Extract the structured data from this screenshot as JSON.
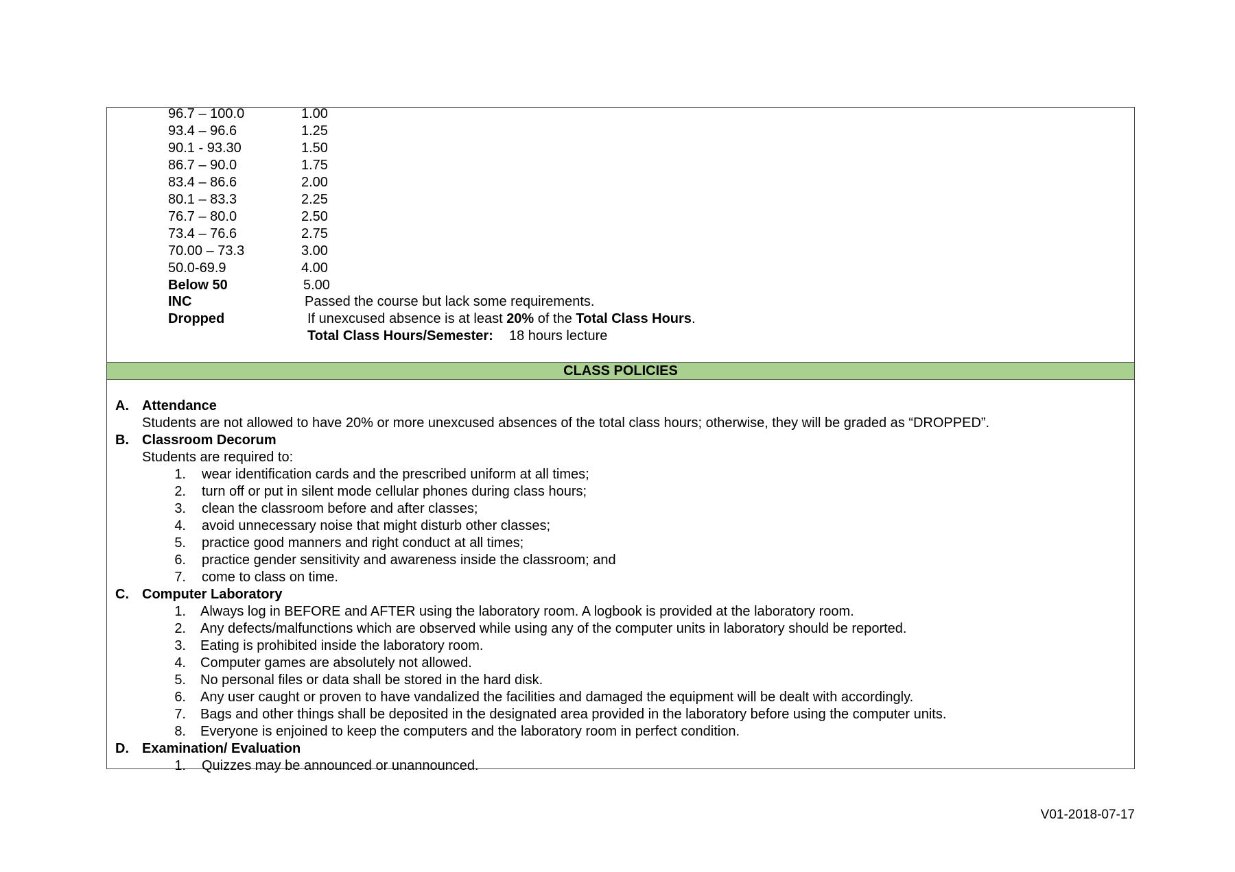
{
  "grading_scale": [
    {
      "range": "96.7 – 100.0",
      "value": "1.00",
      "bold": false
    },
    {
      "range": "93.4 – 96.6",
      "value": "1.25",
      "bold": false
    },
    {
      "range": "90.1 - 93.30",
      "value": "1.50",
      "bold": false
    },
    {
      "range": "86.7 – 90.0",
      "value": "1.75",
      "bold": false
    },
    {
      "range": "83.4 – 86.6",
      "value": "2.00",
      "bold": false
    },
    {
      "range": "80.1 – 83.3",
      "value": "2.25",
      "bold": false
    },
    {
      "range": "76.7 – 80.0",
      "value": "2.50",
      "bold": false
    },
    {
      "range": "73.4 – 76.6",
      "value": "2.75",
      "bold": false
    },
    {
      "range": "70.00 – 73.3",
      "value": "3.00",
      "bold": false
    },
    {
      "range": "50.0-69.9",
      "value": "4.00",
      "bold": false
    },
    {
      "range": "Below 50",
      "value": "5.00",
      "bold": true
    }
  ],
  "inc": {
    "label": "INC",
    "text": "Passed the course but lack some requirements."
  },
  "dropped": {
    "label": "Dropped",
    "text_1": "If unexcused absence is at least ",
    "bold_1": "20%",
    "text_2": " of the ",
    "bold_2": "Total Class Hours",
    "text_3": "."
  },
  "total_hours": {
    "label": "Total Class Hours/Semester:",
    "value": "18 hours lecture"
  },
  "band_title": "CLASS POLICIES",
  "sections": {
    "a": {
      "letter": "A.",
      "title": "Attendance",
      "text": "Students are not allowed to have 20% or more unexcused absences of the total class hours; otherwise, they will be graded as “DROPPED”."
    },
    "b": {
      "letter": "B.",
      "title": "Classroom Decorum",
      "intro": "Students are required to:",
      "items": [
        "wear identification cards and the prescribed uniform at all times;",
        "turn off or put in silent mode cellular phones during class hours;",
        "clean the classroom before and after classes;",
        "avoid unnecessary noise that might disturb other classes;",
        "practice good manners and right conduct at all times;",
        "practice gender sensitivity and awareness inside the classroom; and",
        "come to class on time."
      ]
    },
    "c": {
      "letter": "C.",
      "title": "Computer Laboratory",
      "items": [
        "Always log in BEFORE and AFTER using the laboratory room. A logbook is provided at the laboratory room.",
        "Any defects/malfunctions which are observed while using any of the computer units in laboratory should be reported.",
        "Eating is prohibited inside the laboratory room.",
        "Computer games are absolutely not allowed.",
        "No personal files or data shall be stored in the hard disk.",
        "Any user caught or proven to have vandalized the facilities and damaged the equipment will be dealt with accordingly.",
        "Bags and other things shall be deposited in the designated area provided in the laboratory before using the computer units.",
        "Everyone is enjoined to keep the computers and the laboratory room in perfect condition."
      ]
    },
    "d": {
      "letter": "D.",
      "title": "Examination/ Evaluation",
      "items": [
        "Quizzes may be announced or unannounced."
      ]
    }
  },
  "footer": "V01-2018-07-17"
}
